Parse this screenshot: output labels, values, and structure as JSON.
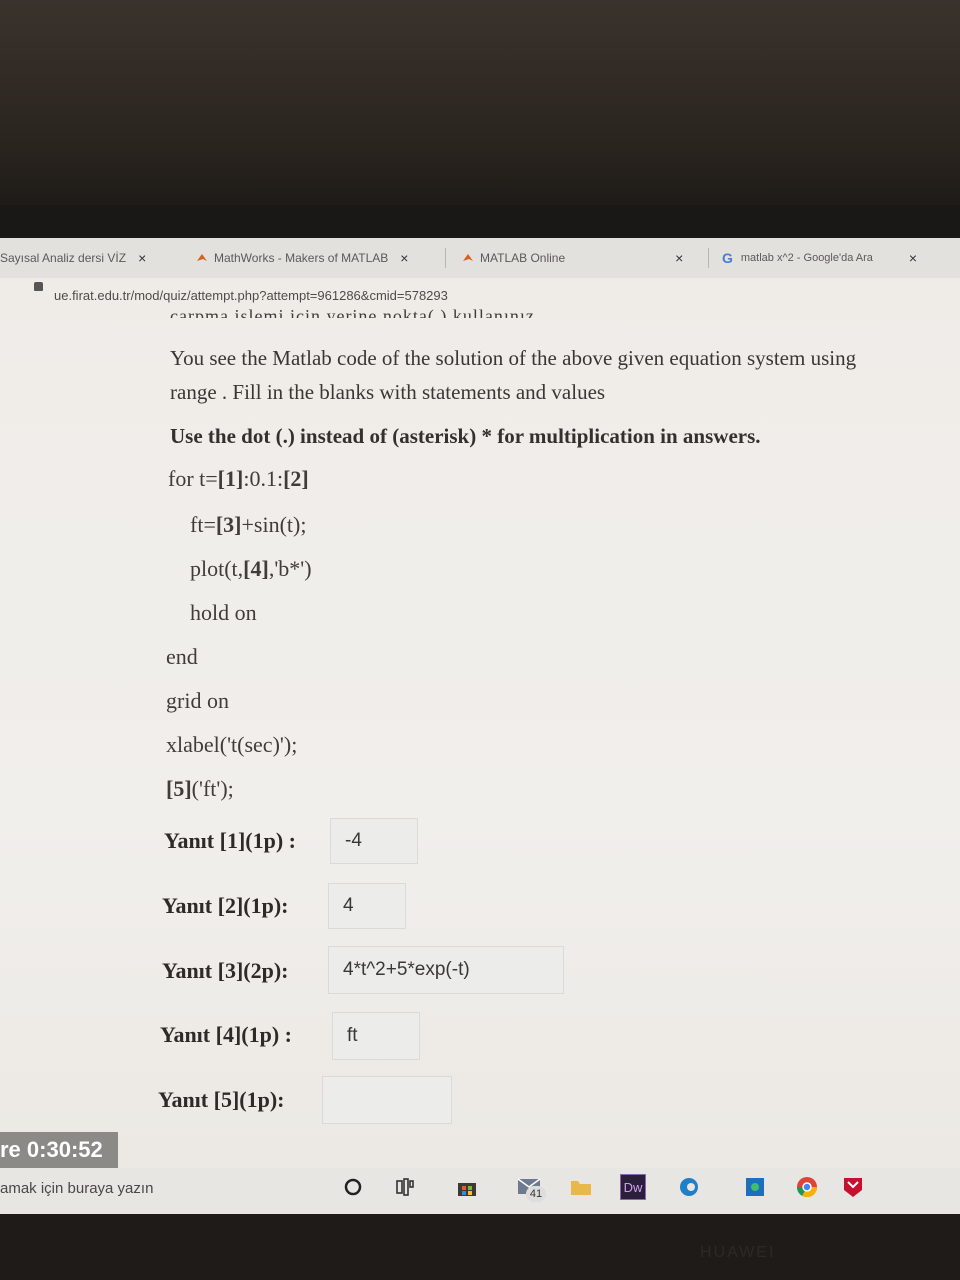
{
  "browser": {
    "tabs": [
      {
        "label": "Sayısal Analiz dersi VİZ",
        "close": "×"
      },
      {
        "label": "MathWorks - Makers of MATLAB",
        "close": "×"
      },
      {
        "label": "MATLAB Online",
        "close": "×"
      },
      {
        "label": "matlab x^2 - Google'da Ara",
        "close": "×"
      }
    ],
    "url": "ue.firat.edu.tr/mod/quiz/attempt.php?attempt=961286&cmid=578293"
  },
  "question": {
    "cut_line": "çarpma işlemi için  yerine nokta(.) kullanınız.",
    "intro_line1": "You see the Matlab code of the solution of the above given equation system using",
    "intro_line2": "range . Fill in the blanks with statements and values",
    "note": "Use the dot (.) instead of (asterisk) * for multiplication in answers.",
    "code": {
      "line1_pre": "for t=",
      "blank1": "[1]",
      "line1_mid": ":0.1:",
      "blank2": "[2]",
      "line2_pre": "ft=",
      "blank3": "[3]",
      "line2_post": "+sin(t);",
      "line3_pre": "plot(t,",
      "blank4": "[4]",
      "line3_post": ",'b*')",
      "line4": "hold on",
      "line5": "end",
      "line6": "grid on",
      "line7": "xlabel('t(sec)');",
      "blank5": "[5]",
      "line8_post": "('ft');"
    },
    "answers": [
      {
        "label": "Yanıt [1](1p) :",
        "value": "-4"
      },
      {
        "label": "Yanıt [2](1p):",
        "value": "4"
      },
      {
        "label": "Yanıt [3](2p):",
        "value": "4*t^2+5*exp(-t)"
      },
      {
        "label": "Yanıt [4](1p) :",
        "value": "ft"
      },
      {
        "label": "Yanıt [5](1p):",
        "value": ""
      }
    ]
  },
  "timer": "re 0:30:52",
  "taskbar": {
    "search_placeholder": "amak için buraya yazın",
    "mail_badge": "41",
    "dw_label": "Dw"
  },
  "brand": "HUAWEI"
}
